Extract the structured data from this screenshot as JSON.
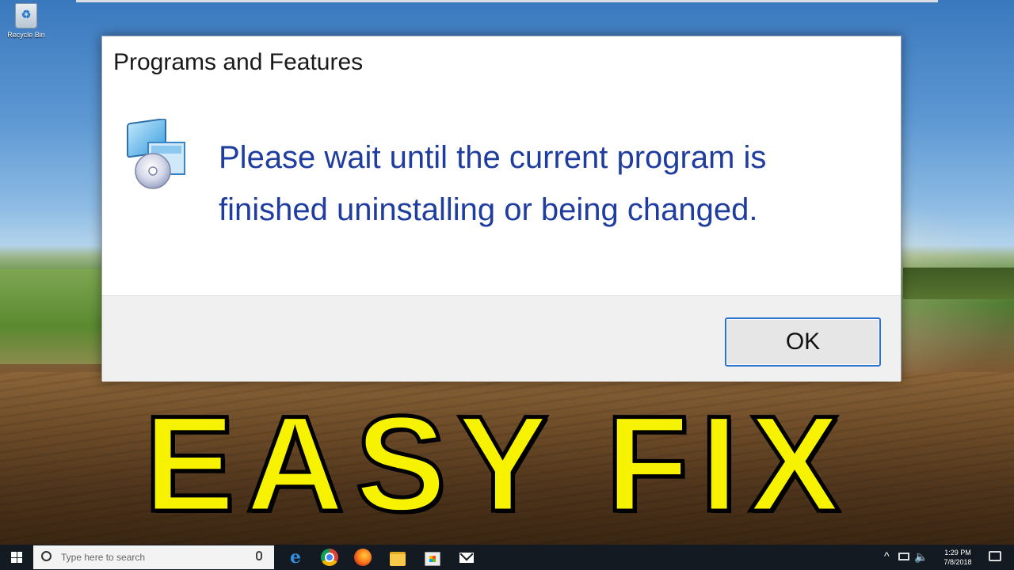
{
  "desktop": {
    "recycle_bin_label": "Recycle Bin"
  },
  "dialog": {
    "title": "Programs and Features",
    "message_line1": "Please wait until the current program is",
    "message_line2": "finished uninstalling or being changed.",
    "icon": "programs-features-icon",
    "ok_label": "OK"
  },
  "overlay": {
    "text": "EASY FIX",
    "color": "#f7f300"
  },
  "taskbar": {
    "search_placeholder": "Type here to search",
    "pinned": [
      "edge-icon",
      "chrome-icon",
      "firefox-icon",
      "file-explorer-icon",
      "store-icon",
      "mail-icon"
    ],
    "clock_time": "1:29 PM",
    "clock_date": "7/8/2018"
  },
  "colors": {
    "message_text": "#1f3d9f",
    "ok_border": "#2a73d0",
    "taskbar": "#141a21"
  }
}
